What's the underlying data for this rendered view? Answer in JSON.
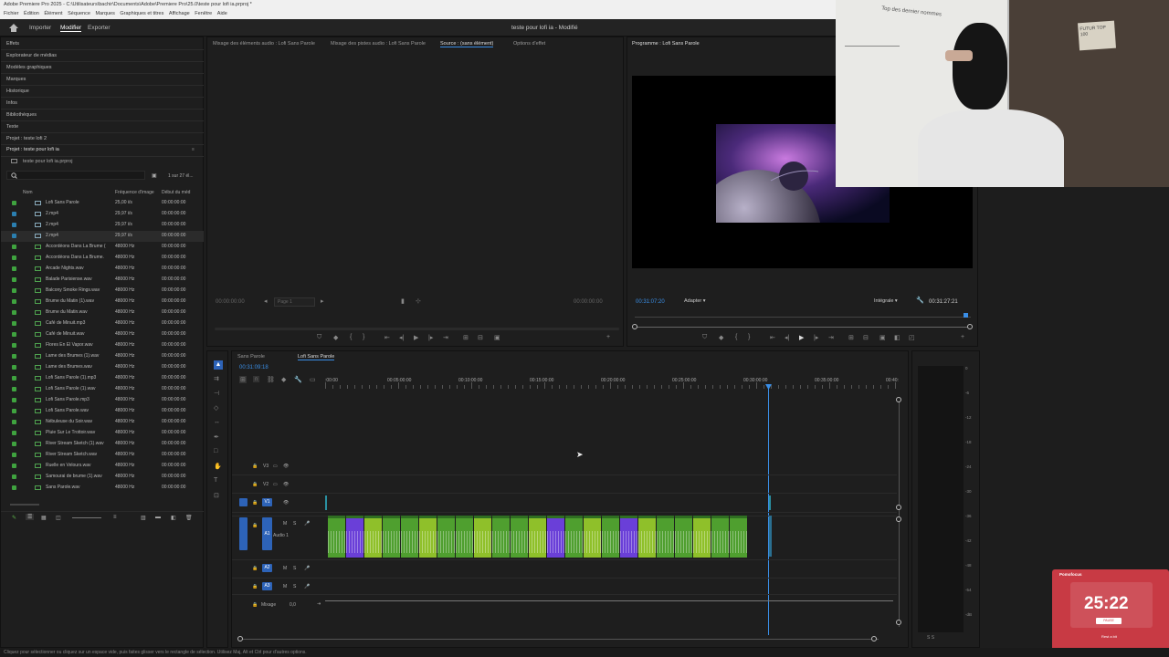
{
  "window": {
    "title": "Adobe Premiere Pro 2025 - C:\\Utilisateurs\\bachir\\Documents\\Adobe\\Premiere Pro\\25.0\\teste pour lofi ia.prproj *",
    "menu": [
      "Fichier",
      "Édition",
      "Élément",
      "Séquence",
      "Marques",
      "Graphiques et titres",
      "Affichage",
      "Fenêtre",
      "Aide"
    ]
  },
  "workspace": {
    "tabs": [
      "Importer",
      "Modifier",
      "Exporter"
    ],
    "active": "Modifier",
    "doc_title": "teste pour lofi ia - Modifié"
  },
  "left_panel": {
    "items": [
      "Effets",
      "Explorateur de médias",
      "Modèles graphiques",
      "Marques",
      "Historique",
      "Infos",
      "Bibliothèques",
      "Texte",
      "Projet : teste lofi 2"
    ],
    "project_tab": "Projet : teste pour lofi ia",
    "project_file": "teste pour lofi ia.prproj",
    "count": "1 sur 27 él...",
    "columns": [
      "Nom",
      "Fréquence d'image",
      "Début du méd"
    ],
    "rows": [
      {
        "name": "Lofi Sans Parole",
        "rate": "25,00 i/s",
        "start": "00:00:00:00",
        "color": "#3fa33f"
      },
      {
        "name": "2.mp4",
        "rate": "29,97 i/s",
        "start": "00:00:00:00",
        "color": "#2b7fb0"
      },
      {
        "name": "2.mp4",
        "rate": "29,97 i/s",
        "start": "00:00:00:00",
        "color": "#2b7fb0"
      },
      {
        "name": "2.mp4",
        "rate": "29,97 i/s",
        "start": "00:00:00:00",
        "color": "#2b7fb0"
      },
      {
        "name": "Accordéons Dans La Brume (",
        "rate": "48000  Hz",
        "start": "00:00:00:00",
        "color": "#3fa33f"
      },
      {
        "name": "Accordéons Dans La Brume.",
        "rate": "48000  Hz",
        "start": "00:00:00:00",
        "color": "#3fa33f"
      },
      {
        "name": "Arcade Nights.wav",
        "rate": "48000  Hz",
        "start": "00:00:00:00",
        "color": "#3fa33f"
      },
      {
        "name": "Balade Parisiense.wav",
        "rate": "48000  Hz",
        "start": "00:00:00:00",
        "color": "#3fa33f"
      },
      {
        "name": "Balcony Smoke Rings.wav",
        "rate": "48000  Hz",
        "start": "00:00:00:00",
        "color": "#3fa33f"
      },
      {
        "name": "Brume du Matin (1).wav",
        "rate": "48000  Hz",
        "start": "00:00:00:00",
        "color": "#3fa33f"
      },
      {
        "name": "Brume du Matin.wav",
        "rate": "48000  Hz",
        "start": "00:00:00:00",
        "color": "#3fa33f"
      },
      {
        "name": "Café de Minuit.mp3",
        "rate": "48000  Hz",
        "start": "00:00:00:00",
        "color": "#3fa33f"
      },
      {
        "name": "Café de Minuit.wav",
        "rate": "48000  Hz",
        "start": "00:00:00:00",
        "color": "#3fa33f"
      },
      {
        "name": "Flores En El Vapor.wav",
        "rate": "48000  Hz",
        "start": "00:00:00:00",
        "color": "#3fa33f"
      },
      {
        "name": "Lame des Brumes (1).wav",
        "rate": "48000  Hz",
        "start": "00:00:00:00",
        "color": "#3fa33f"
      },
      {
        "name": "Lame des Brumes.wav",
        "rate": "48000  Hz",
        "start": "00:00:00:00",
        "color": "#3fa33f"
      },
      {
        "name": "Lofi Sans Parole (1).mp3",
        "rate": "48000  Hz",
        "start": "00:00:00:00",
        "color": "#3fa33f"
      },
      {
        "name": "Lofi Sans Parole (1).wav",
        "rate": "48000  Hz",
        "start": "00:00:00:00",
        "color": "#3fa33f"
      },
      {
        "name": "Lofi Sans Parole.mp3",
        "rate": "48000  Hz",
        "start": "00:00:00:00",
        "color": "#3fa33f"
      },
      {
        "name": "Lofi Sans Parole.wav",
        "rate": "48000  Hz",
        "start": "00:00:00:00",
        "color": "#3fa33f"
      },
      {
        "name": "Nébuleuse du Soir.wav",
        "rate": "48000  Hz",
        "start": "00:00:00:00",
        "color": "#3fa33f"
      },
      {
        "name": "Pluie Sur Le Trottoir.wav",
        "rate": "48000  Hz",
        "start": "00:00:00:00",
        "color": "#3fa33f"
      },
      {
        "name": "River Stream Sketch (1).wav",
        "rate": "48000  Hz",
        "start": "00:00:00:00",
        "color": "#3fa33f"
      },
      {
        "name": "River Stream Sketch.wav",
        "rate": "48000  Hz",
        "start": "00:00:00:00",
        "color": "#3fa33f"
      },
      {
        "name": "Ruelle en Velours.wav",
        "rate": "48000  Hz",
        "start": "00:00:00:00",
        "color": "#3fa33f"
      },
      {
        "name": "Samourai de brume (1).wav",
        "rate": "48000  Hz",
        "start": "00:00:00:00",
        "color": "#3fa33f"
      },
      {
        "name": "Sans Parole.wav",
        "rate": "48000  Hz",
        "start": "00:00:00:00",
        "color": "#3fa33f"
      }
    ]
  },
  "source_panel": {
    "tabs": [
      "Mixage des éléments audio : Lofi Sans Parole",
      "Mixage des pistes audio : Lofi Sans Parole",
      "Source : (sans élément)",
      "Options d'effet"
    ],
    "active_tab": "Source : (sans élément)",
    "tc_left": "00:00:00:00",
    "tc_right": "00:00:00:00",
    "page": "Page 1"
  },
  "program_panel": {
    "tab": "Programme : Lofi Sans Parole",
    "timecode": "00:31:07:20",
    "fit": "Adapter",
    "quality": "Intégrale",
    "duration": "00:31:27:21"
  },
  "timeline": {
    "tabs": [
      "Sans Parole",
      "Lofi Sans Parole"
    ],
    "active_tab": "Lofi Sans Parole",
    "timecode": "00:31:09:18",
    "ruler": [
      ":00:00",
      "00:05:00:00",
      "00:10:00:00",
      "00:15:00:00",
      "00:20:00:00",
      "00:25:00:00",
      "00:30:00:00",
      "00:35:00:00",
      "00:40:"
    ],
    "tracks": [
      "V3",
      "V2",
      "V1",
      "A1",
      "A2",
      "A3"
    ],
    "audio_track_name": "Audio 1",
    "mix_label": "Mixage",
    "mix_value": "0,0"
  },
  "meters": {
    "scale": [
      "0",
      "-6",
      "-12",
      "-18",
      "-24",
      "-30",
      "-36",
      "-42",
      "-48",
      "-54",
      "-dB"
    ],
    "bottom": "S  S"
  },
  "timer": {
    "app": "Pomofocus",
    "time": "25:22",
    "button": "PAUSE",
    "label": "Rest a bit"
  },
  "webcam_board": {
    "title": "Top des dernier nommes",
    "note": "FUTUR TOP 100"
  },
  "status": "Cliquez pour sélectionner ou cliquez sur un espace vide, puis faites glisser vers le rectangle de sélection. Utilisez Maj, Alt et Ctrl pour d'autres options.",
  "colors": {
    "accent": "#3a8ee6",
    "audio_clip": "#4f9f2f",
    "audio_clip_alt": "#8fc02a",
    "purple_clip": "#6a3fd8"
  }
}
